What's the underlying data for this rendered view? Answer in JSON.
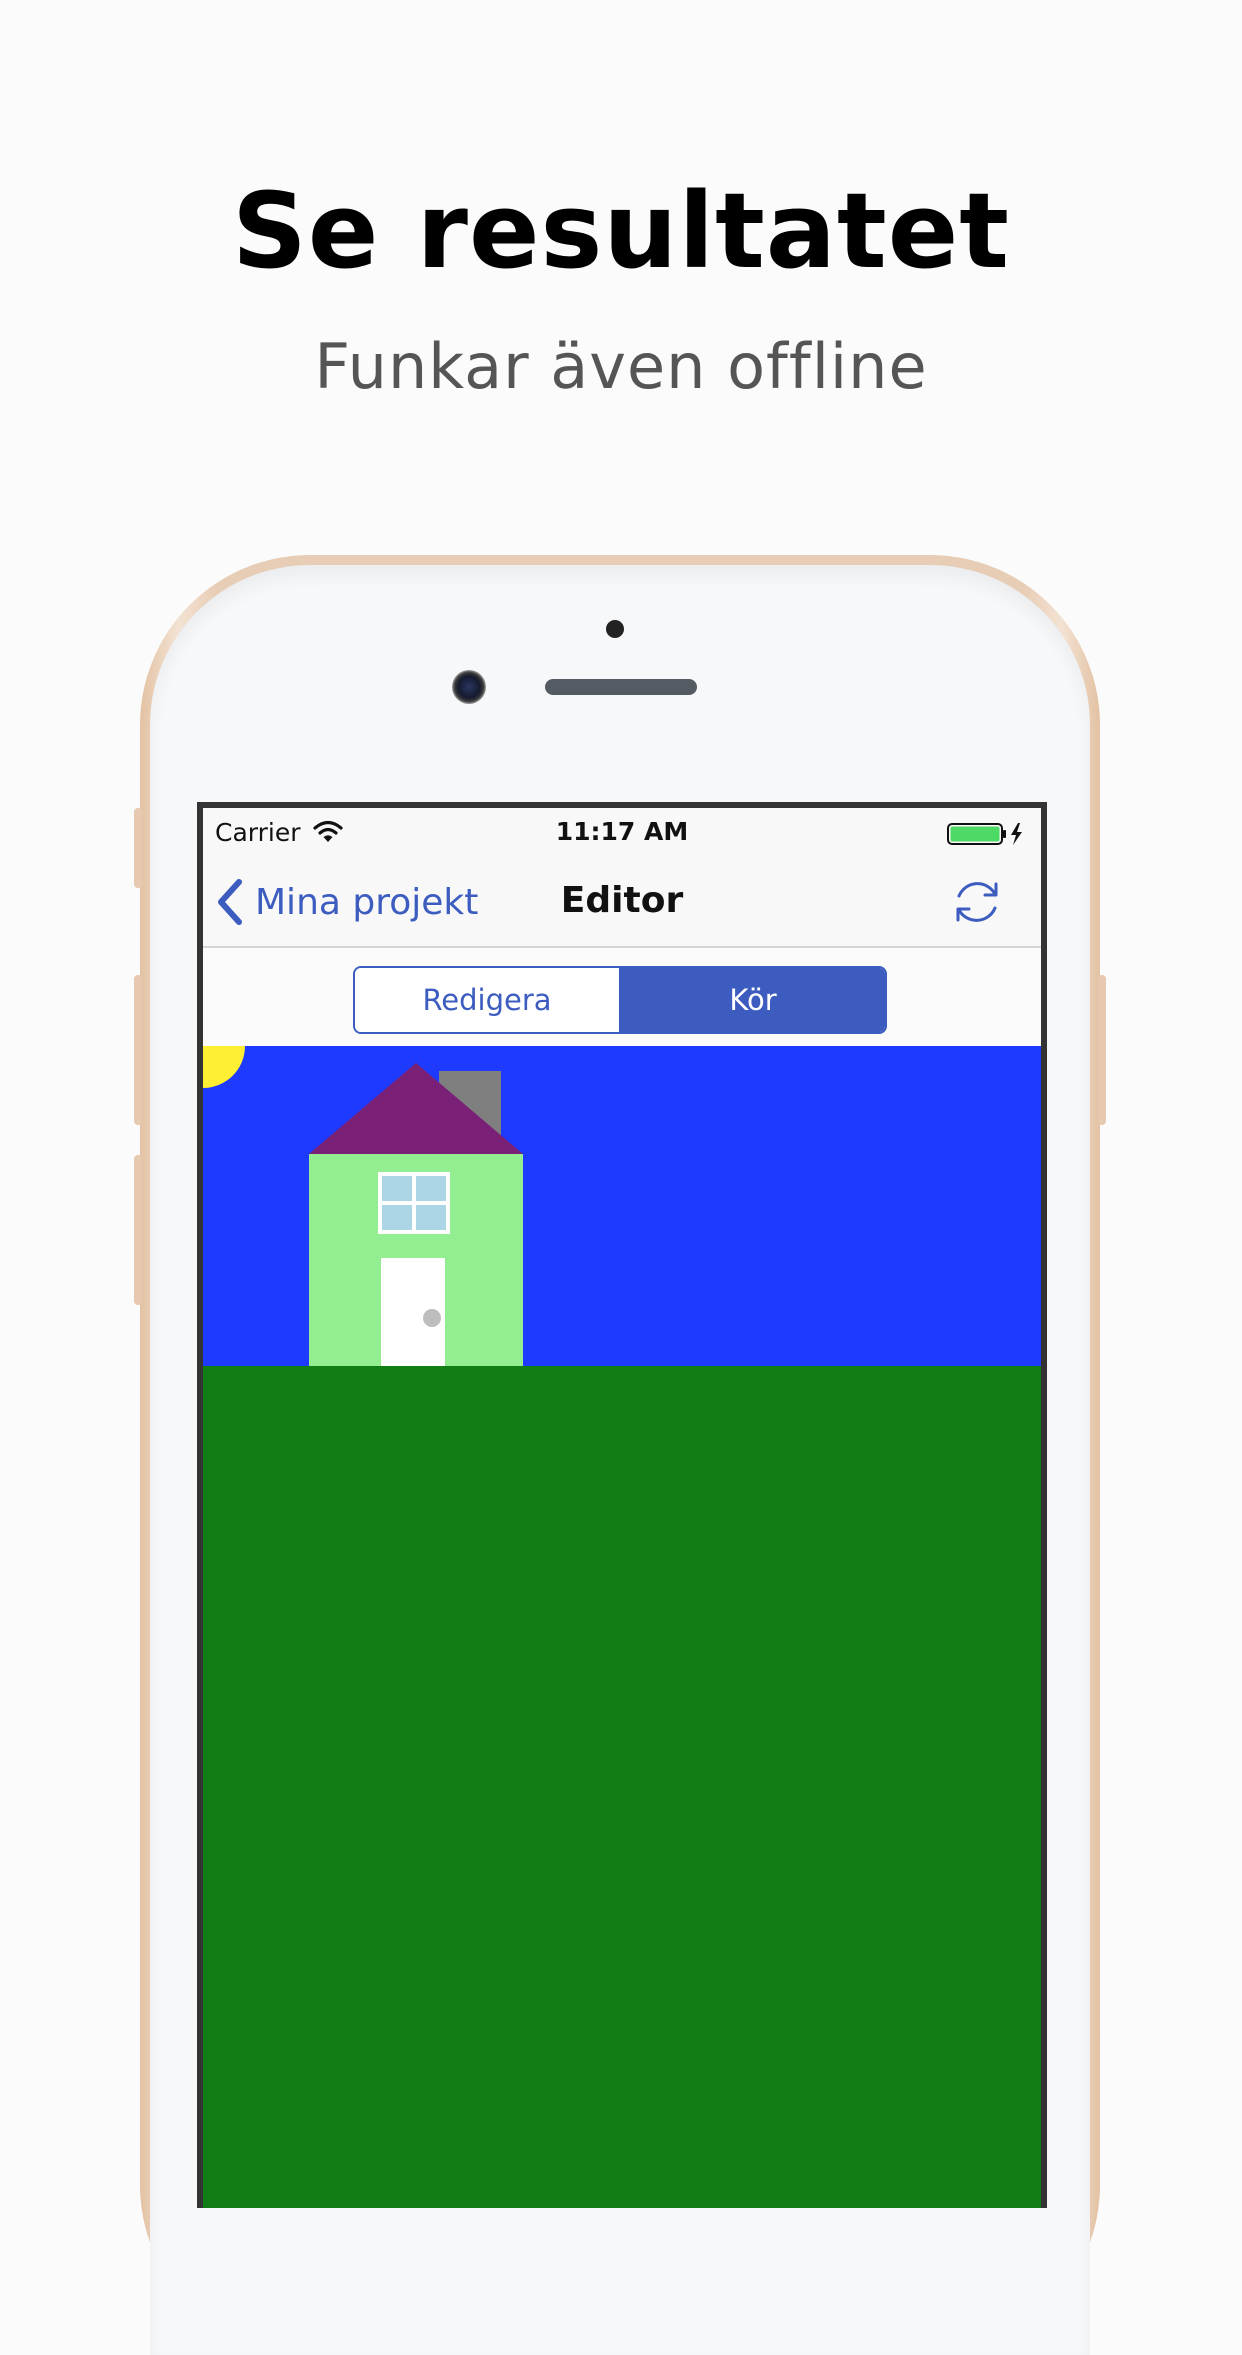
{
  "hero": {
    "title": "Se resultatet",
    "subtitle": "Funkar även offline"
  },
  "status_bar": {
    "carrier": "Carrier",
    "time": "11:17 AM",
    "battery_level": 1.0,
    "wifi_icon": "wifi-icon",
    "battery_icon": "battery-charging-icon"
  },
  "nav": {
    "back_label": "Mina projekt",
    "title": "Editor",
    "back_icon": "chevron-left-icon",
    "refresh_icon": "refresh-icon"
  },
  "segments": {
    "edit_label": "Redigera",
    "run_label": "Kör",
    "selected": "Kör"
  },
  "scene": {
    "sky_color": "#1f3aff",
    "ground_color": "#107e14",
    "sun_color": "#ffef32",
    "wall_color": "#93ee91",
    "roof_color": "#7a2177",
    "chimney_color": "#7f7f7f",
    "window_color": "#acd6e5",
    "door_color": "#ffffff",
    "knob_color": "#bdbdbd"
  },
  "colors": {
    "accent": "#3c5cbf"
  }
}
